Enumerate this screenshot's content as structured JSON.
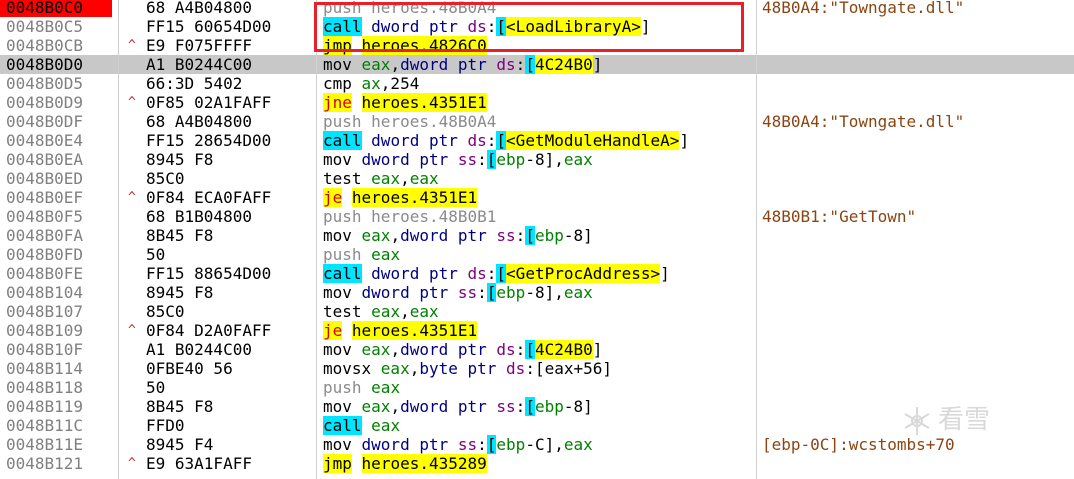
{
  "rows": [
    {
      "addr": "0048B0C0",
      "arrow": "",
      "bytes": "68 A4B04800",
      "instr": [
        [
          "pushop",
          "push "
        ],
        [
          "pushsym",
          "heroes.48B0A4"
        ]
      ],
      "comment": "48B0A4:\"Towngate.dll\"",
      "eip": true,
      "current": false
    },
    {
      "addr": "0048B0C5",
      "arrow": "",
      "bytes": "FF15 60654D00",
      "instr": [
        [
          "call",
          "call"
        ],
        [
          "plain",
          " "
        ],
        [
          "ptr",
          "dword ptr "
        ],
        [
          "seg",
          "ds"
        ],
        [
          "plain",
          ":"
        ],
        [
          "bracket",
          "["
        ],
        [
          "api",
          "<LoadLibraryA>"
        ],
        [
          "plain",
          "]"
        ]
      ],
      "comment": "",
      "eip": false,
      "current": false
    },
    {
      "addr": "0048B0CB",
      "arrow": "^",
      "bytes": "E9 F075FFFF",
      "instr": [
        [
          "jmp",
          "jmp"
        ],
        [
          "plain",
          " "
        ],
        [
          "target",
          "heroes.4826C0"
        ]
      ],
      "comment": "",
      "eip": false,
      "current": false
    },
    {
      "addr": "0048B0D0",
      "arrow": "",
      "bytes": "A1 B0244C00",
      "instr": [
        [
          "plain",
          "mov "
        ],
        [
          "reg",
          "eax"
        ],
        [
          "plain",
          ","
        ],
        [
          "ptr",
          "dword ptr "
        ],
        [
          "seg",
          "ds"
        ],
        [
          "plain",
          ":"
        ],
        [
          "bracket",
          "["
        ],
        [
          "addr",
          "4C24B0"
        ],
        [
          "plain",
          "]"
        ]
      ],
      "comment": "",
      "eip": false,
      "current": true
    },
    {
      "addr": "0048B0D5",
      "arrow": "",
      "bytes": "66:3D 5402",
      "instr": [
        [
          "plain",
          "cmp "
        ],
        [
          "reg",
          "ax"
        ],
        [
          "plain",
          ",254"
        ]
      ],
      "comment": "",
      "eip": false,
      "current": false
    },
    {
      "addr": "0048B0D9",
      "arrow": "^",
      "bytes": "0F85 02A1FAFF",
      "instr": [
        [
          "jcc",
          "jne"
        ],
        [
          "plain",
          " "
        ],
        [
          "target",
          "heroes.4351E1"
        ]
      ],
      "comment": "",
      "eip": false,
      "current": false
    },
    {
      "addr": "0048B0DF",
      "arrow": "",
      "bytes": "68 A4B04800",
      "instr": [
        [
          "pushop",
          "push "
        ],
        [
          "pushsym",
          "heroes.48B0A4"
        ]
      ],
      "comment": "48B0A4:\"Towngate.dll\"",
      "eip": false,
      "current": false
    },
    {
      "addr": "0048B0E4",
      "arrow": "",
      "bytes": "FF15 28654D00",
      "instr": [
        [
          "call",
          "call"
        ],
        [
          "plain",
          " "
        ],
        [
          "ptr",
          "dword ptr "
        ],
        [
          "seg",
          "ds"
        ],
        [
          "plain",
          ":"
        ],
        [
          "bracket",
          "["
        ],
        [
          "api",
          "<GetModuleHandleA>"
        ],
        [
          "plain",
          "]"
        ]
      ],
      "comment": "",
      "eip": false,
      "current": false
    },
    {
      "addr": "0048B0EA",
      "arrow": "",
      "bytes": "8945 F8",
      "instr": [
        [
          "plain",
          "mov "
        ],
        [
          "ptr",
          "dword ptr "
        ],
        [
          "seg",
          "ss"
        ],
        [
          "plain",
          ":"
        ],
        [
          "bracket",
          "["
        ],
        [
          "reg",
          "ebp"
        ],
        [
          "plain",
          "-8]"
        ],
        [
          "plain",
          ","
        ],
        [
          "reg",
          "eax"
        ]
      ],
      "comment": "",
      "eip": false,
      "current": false
    },
    {
      "addr": "0048B0ED",
      "arrow": "",
      "bytes": "85C0",
      "instr": [
        [
          "plain",
          "test "
        ],
        [
          "reg",
          "eax"
        ],
        [
          "plain",
          ","
        ],
        [
          "reg",
          "eax"
        ]
      ],
      "comment": "",
      "eip": false,
      "current": false
    },
    {
      "addr": "0048B0EF",
      "arrow": "^",
      "bytes": "0F84 ECA0FAFF",
      "instr": [
        [
          "jcc",
          "je"
        ],
        [
          "plain",
          " "
        ],
        [
          "target",
          "heroes.4351E1"
        ]
      ],
      "comment": "",
      "eip": false,
      "current": false
    },
    {
      "addr": "0048B0F5",
      "arrow": "",
      "bytes": "68 B1B04800",
      "instr": [
        [
          "pushop",
          "push "
        ],
        [
          "pushsym",
          "heroes.48B0B1"
        ]
      ],
      "comment": "48B0B1:\"GetTown\"",
      "eip": false,
      "current": false
    },
    {
      "addr": "0048B0FA",
      "arrow": "",
      "bytes": "8B45 F8",
      "instr": [
        [
          "plain",
          "mov "
        ],
        [
          "reg",
          "eax"
        ],
        [
          "plain",
          ","
        ],
        [
          "ptr",
          "dword ptr "
        ],
        [
          "seg",
          "ss"
        ],
        [
          "plain",
          ":"
        ],
        [
          "bracket",
          "["
        ],
        [
          "reg",
          "ebp"
        ],
        [
          "plain",
          "-8]"
        ]
      ],
      "comment": "",
      "eip": false,
      "current": false
    },
    {
      "addr": "0048B0FD",
      "arrow": "",
      "bytes": "50",
      "instr": [
        [
          "pushop",
          "push "
        ],
        [
          "reg",
          "eax"
        ]
      ],
      "comment": "",
      "eip": false,
      "current": false
    },
    {
      "addr": "0048B0FE",
      "arrow": "",
      "bytes": "FF15 88654D00",
      "instr": [
        [
          "call",
          "call"
        ],
        [
          "plain",
          " "
        ],
        [
          "ptr",
          "dword ptr "
        ],
        [
          "seg",
          "ds"
        ],
        [
          "plain",
          ":"
        ],
        [
          "bracket",
          "["
        ],
        [
          "api",
          "<GetProcAddress>"
        ],
        [
          "plain",
          "]"
        ]
      ],
      "comment": "",
      "eip": false,
      "current": false
    },
    {
      "addr": "0048B104",
      "arrow": "",
      "bytes": "8945 F8",
      "instr": [
        [
          "plain",
          "mov "
        ],
        [
          "ptr",
          "dword ptr "
        ],
        [
          "seg",
          "ss"
        ],
        [
          "plain",
          ":"
        ],
        [
          "bracket",
          "["
        ],
        [
          "reg",
          "ebp"
        ],
        [
          "plain",
          "-8]"
        ],
        [
          "plain",
          ","
        ],
        [
          "reg",
          "eax"
        ]
      ],
      "comment": "",
      "eip": false,
      "current": false
    },
    {
      "addr": "0048B107",
      "arrow": "",
      "bytes": "85C0",
      "instr": [
        [
          "plain",
          "test "
        ],
        [
          "reg",
          "eax"
        ],
        [
          "plain",
          ","
        ],
        [
          "reg",
          "eax"
        ]
      ],
      "comment": "",
      "eip": false,
      "current": false
    },
    {
      "addr": "0048B109",
      "arrow": "^",
      "bytes": "0F84 D2A0FAFF",
      "instr": [
        [
          "jcc",
          "je"
        ],
        [
          "plain",
          " "
        ],
        [
          "target",
          "heroes.4351E1"
        ]
      ],
      "comment": "",
      "eip": false,
      "current": false
    },
    {
      "addr": "0048B10F",
      "arrow": "",
      "bytes": "A1 B0244C00",
      "instr": [
        [
          "plain",
          "mov "
        ],
        [
          "reg",
          "eax"
        ],
        [
          "plain",
          ","
        ],
        [
          "ptr",
          "dword ptr "
        ],
        [
          "seg",
          "ds"
        ],
        [
          "plain",
          ":"
        ],
        [
          "bracket",
          "["
        ],
        [
          "addr",
          "4C24B0"
        ],
        [
          "plain",
          "]"
        ]
      ],
      "comment": "",
      "eip": false,
      "current": false
    },
    {
      "addr": "0048B114",
      "arrow": "",
      "bytes": "0FBE40 56",
      "instr": [
        [
          "plain",
          "movsx "
        ],
        [
          "reg",
          "eax"
        ],
        [
          "plain",
          ","
        ],
        [
          "ptr",
          "byte ptr "
        ],
        [
          "seg",
          "ds"
        ],
        [
          "plain",
          ":[eax+56]"
        ]
      ],
      "comment": "",
      "eip": false,
      "current": false
    },
    {
      "addr": "0048B118",
      "arrow": "",
      "bytes": "50",
      "instr": [
        [
          "pushop",
          "push "
        ],
        [
          "reg",
          "eax"
        ]
      ],
      "comment": "",
      "eip": false,
      "current": false
    },
    {
      "addr": "0048B119",
      "arrow": "",
      "bytes": "8B45 F8",
      "instr": [
        [
          "plain",
          "mov "
        ],
        [
          "reg",
          "eax"
        ],
        [
          "plain",
          ","
        ],
        [
          "ptr",
          "dword ptr "
        ],
        [
          "seg",
          "ss"
        ],
        [
          "plain",
          ":"
        ],
        [
          "bracket",
          "["
        ],
        [
          "reg",
          "ebp"
        ],
        [
          "plain",
          "-8]"
        ]
      ],
      "comment": "",
      "eip": false,
      "current": false
    },
    {
      "addr": "0048B11C",
      "arrow": "",
      "bytes": "FFD0",
      "instr": [
        [
          "call",
          "call"
        ],
        [
          "plain",
          " "
        ],
        [
          "reg",
          "eax"
        ]
      ],
      "comment": "",
      "eip": false,
      "current": false
    },
    {
      "addr": "0048B11E",
      "arrow": "",
      "bytes": "8945 F4",
      "instr": [
        [
          "plain",
          "mov "
        ],
        [
          "ptr",
          "dword ptr "
        ],
        [
          "seg",
          "ss"
        ],
        [
          "plain",
          ":"
        ],
        [
          "bracket",
          "["
        ],
        [
          "reg",
          "ebp"
        ],
        [
          "plain",
          "-C]"
        ],
        [
          "plain",
          ","
        ],
        [
          "reg",
          "eax"
        ]
      ],
      "comment": "[ebp-0C]:wcstombs+70",
      "eip": false,
      "current": false
    },
    {
      "addr": "0048B121",
      "arrow": "^",
      "bytes": "E9 63A1FAFF",
      "instr": [
        [
          "jmp",
          "jmp"
        ],
        [
          "plain",
          " "
        ],
        [
          "target",
          "heroes.435289"
        ]
      ],
      "comment": "",
      "eip": false,
      "current": false
    }
  ],
  "watermark": {
    "text": "看雪"
  },
  "colors": {
    "eip_bg": "#ff0000",
    "current_row_bg": "#c8c8c8",
    "call_bg": "#00e5ff",
    "jump_bg": "#ffff00",
    "highlight_box": "#e8202a",
    "comment_text": "#8b4513"
  }
}
